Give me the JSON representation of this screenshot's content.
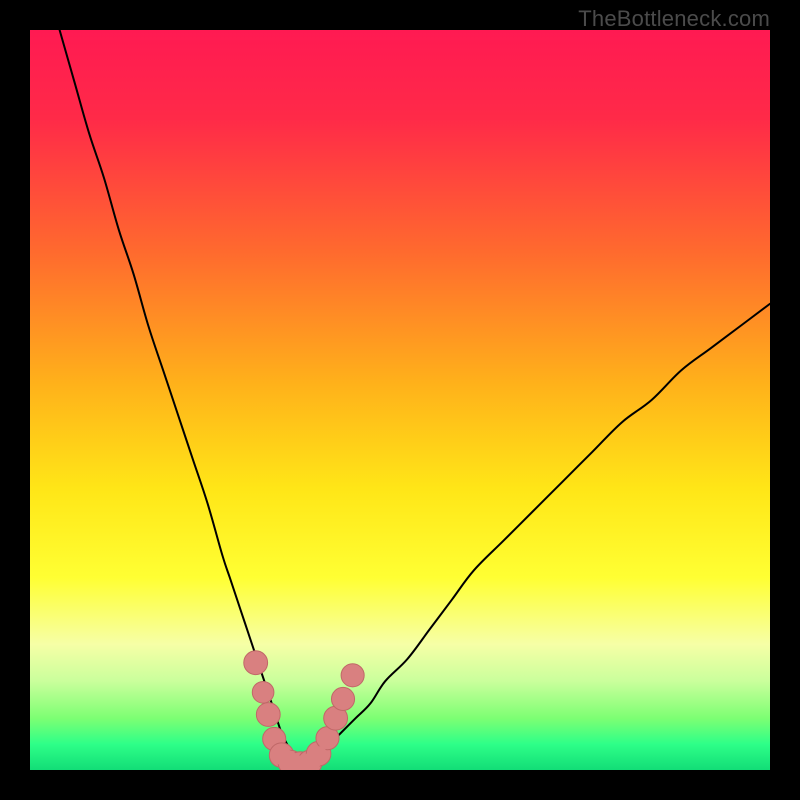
{
  "watermark": "TheBottleneck.com",
  "colors": {
    "frame": "#000000",
    "gradient_stops": [
      {
        "offset": 0.0,
        "color": "#ff1a52"
      },
      {
        "offset": 0.12,
        "color": "#ff2a48"
      },
      {
        "offset": 0.3,
        "color": "#ff6a2e"
      },
      {
        "offset": 0.48,
        "color": "#ffb21a"
      },
      {
        "offset": 0.62,
        "color": "#ffe617"
      },
      {
        "offset": 0.74,
        "color": "#ffff33"
      },
      {
        "offset": 0.83,
        "color": "#f6ffa6"
      },
      {
        "offset": 0.88,
        "color": "#caff9c"
      },
      {
        "offset": 0.93,
        "color": "#7dff73"
      },
      {
        "offset": 0.965,
        "color": "#2eff88"
      },
      {
        "offset": 1.0,
        "color": "#12dd77"
      }
    ],
    "curve": "#000000",
    "marker_fill": "#d98080",
    "marker_stroke": "#c06868"
  },
  "chart_data": {
    "type": "line",
    "title": "",
    "xlabel": "",
    "ylabel": "",
    "xlim": [
      0,
      100
    ],
    "ylim": [
      0,
      100
    ],
    "series": [
      {
        "name": "left-branch",
        "x": [
          4,
          6,
          8,
          10,
          12,
          14,
          16,
          18,
          20,
          22,
          24,
          26,
          27,
          28,
          29,
          30,
          31,
          32,
          33,
          34,
          35,
          36
        ],
        "y": [
          100,
          93,
          86,
          80,
          73,
          67,
          60,
          54,
          48,
          42,
          36,
          29,
          26,
          23,
          20,
          17,
          14,
          11,
          8,
          5,
          3,
          1
        ]
      },
      {
        "name": "valley-floor",
        "x": [
          33,
          34,
          35,
          36,
          37,
          38,
          39,
          40
        ],
        "y": [
          2.2,
          1.2,
          0.6,
          0.3,
          0.3,
          0.6,
          1.2,
          2.4
        ]
      },
      {
        "name": "right-branch",
        "x": [
          38,
          40,
          42,
          44,
          46,
          48,
          51,
          54,
          57,
          60,
          64,
          68,
          72,
          76,
          80,
          84,
          88,
          92,
          96,
          100
        ],
        "y": [
          1,
          3,
          5,
          7,
          9,
          12,
          15,
          19,
          23,
          27,
          31,
          35,
          39,
          43,
          47,
          50,
          54,
          57,
          60,
          63
        ]
      }
    ],
    "markers": {
      "name": "highlight-points",
      "points": [
        {
          "x": 30.5,
          "y": 14.5,
          "r": 1.6
        },
        {
          "x": 31.5,
          "y": 10.5,
          "r": 1.3
        },
        {
          "x": 32.2,
          "y": 7.5,
          "r": 1.6
        },
        {
          "x": 33.0,
          "y": 4.2,
          "r": 1.5
        },
        {
          "x": 34.0,
          "y": 2.0,
          "r": 1.7
        },
        {
          "x": 35.2,
          "y": 1.0,
          "r": 1.7
        },
        {
          "x": 36.5,
          "y": 0.8,
          "r": 1.7
        },
        {
          "x": 37.8,
          "y": 1.0,
          "r": 1.7
        },
        {
          "x": 39.0,
          "y": 2.2,
          "r": 1.7
        },
        {
          "x": 40.2,
          "y": 4.3,
          "r": 1.5
        },
        {
          "x": 41.3,
          "y": 7.0,
          "r": 1.6
        },
        {
          "x": 42.3,
          "y": 9.6,
          "r": 1.5
        },
        {
          "x": 43.6,
          "y": 12.8,
          "r": 1.5
        }
      ]
    }
  }
}
